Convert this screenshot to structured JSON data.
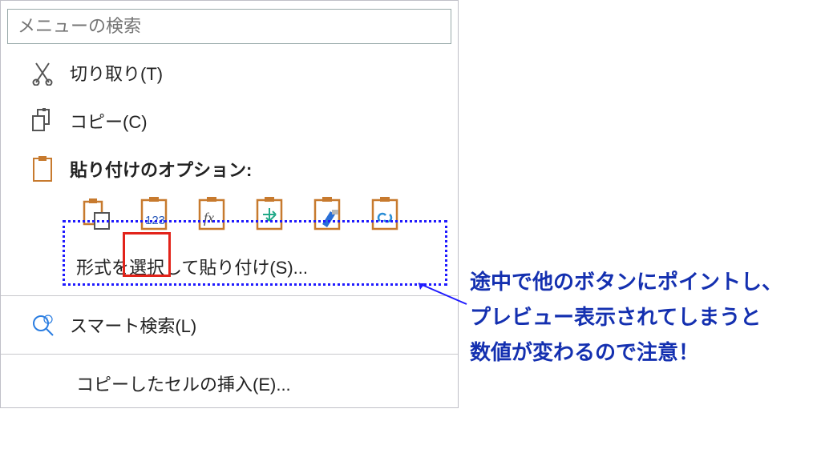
{
  "search": {
    "placeholder": "メニューの検索"
  },
  "menu": {
    "cut_label": "切り取り(T)",
    "copy_label": "コピー(C)",
    "paste_options_label": "貼り付けのオプション:",
    "paste_special_label": "形式を選択して貼り付け(S)...",
    "smart_lookup_label": "スマート検索(L)",
    "insert_copied_label": "コピーしたセルの挿入(E)...",
    "paste_options": [
      {
        "name": "paste-all-icon"
      },
      {
        "name": "paste-values-icon"
      },
      {
        "name": "paste-formula-icon"
      },
      {
        "name": "paste-transpose-icon"
      },
      {
        "name": "paste-formatting-icon"
      },
      {
        "name": "paste-link-icon"
      }
    ]
  },
  "annotation": {
    "line1": "途中で他のボタンにポイントし、",
    "line2": "プレビュー表示されてしまうと",
    "line3": "数値が変わるので注意！"
  }
}
